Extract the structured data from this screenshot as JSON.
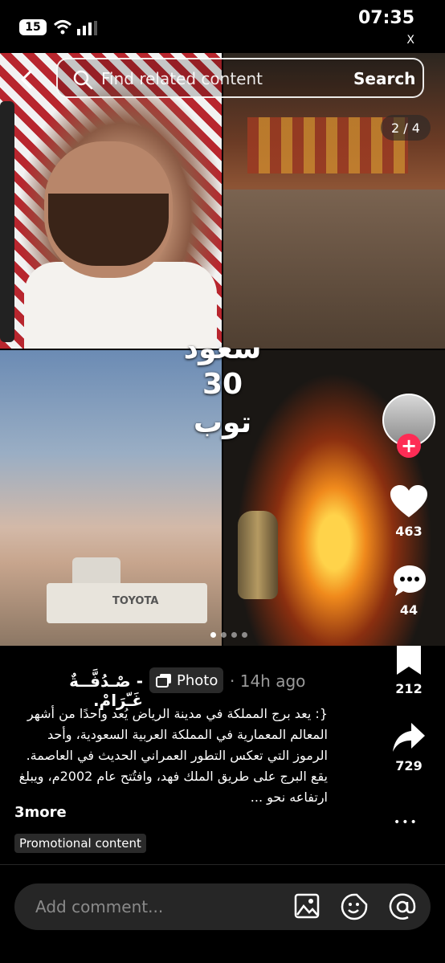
{
  "status": {
    "battery": "15",
    "time": "07:35",
    "close": "X"
  },
  "search": {
    "placeholder": "Find related content",
    "button": "Search"
  },
  "gallery": {
    "counter": "2 / 4",
    "overlay_lines": [
      "سعود",
      "30",
      "توب"
    ],
    "truck_label": "TOYOTA"
  },
  "rail": {
    "likes": "463",
    "comments": "44",
    "saves": "212",
    "shares": "729",
    "more_glyph": "•••"
  },
  "post": {
    "author": "- صْـدُفَّــةٌ غَـّرَامْ.",
    "badge": "Photo",
    "time_ago": "· 14h ago",
    "description": "{: يعد برج المملكة في مدينة الرياض يُعد واحدًا من أشهر المعالم المعمارية في المملكة العربية السعودية، وأحد الرموز التي تعكس التطور العمراني الحديث في العاصمة. يقع البرج على طريق الملك فهد، وافتُتح عام 2002م، ويبلغ ارتفاعه نحو ...",
    "more": "3more",
    "promotional": "Promotional content"
  },
  "comment": {
    "placeholder": "Add comment..."
  },
  "colors": {
    "accent": "#fe2c55",
    "background": "#000000"
  },
  "icons": [
    "back-icon",
    "search-icon",
    "heart-icon",
    "comment-icon",
    "bookmark-icon",
    "share-icon",
    "image-icon",
    "emoji-icon",
    "mention-icon"
  ]
}
